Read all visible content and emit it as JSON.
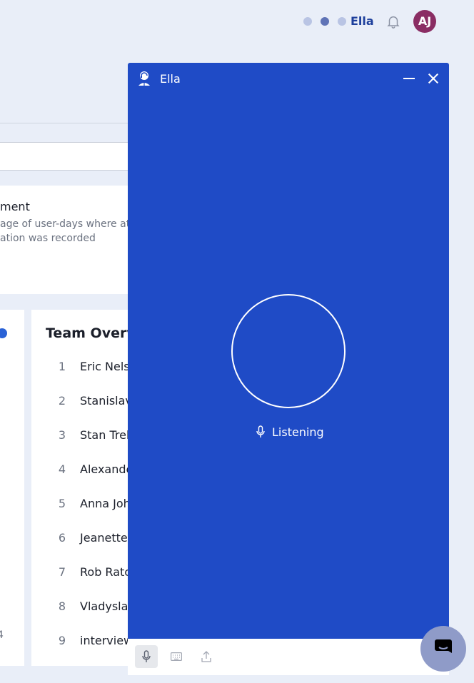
{
  "topbar": {
    "assistant_label": "Ella",
    "avatar_initials": "AJ",
    "avatar_color": "#8a2d63"
  },
  "metric_card": {
    "title": "ment",
    "desc_line1": "age of user-days where at le",
    "desc_line2": "ation was recorded"
  },
  "left_card": {
    "footer_value": "4"
  },
  "team": {
    "title": "Team Overv",
    "members": [
      {
        "rank": "1",
        "name": "Eric Nelso"
      },
      {
        "rank": "2",
        "name": "Stanislav"
      },
      {
        "rank": "3",
        "name": "Stan Treb"
      },
      {
        "rank": "4",
        "name": "Alexande"
      },
      {
        "rank": "5",
        "name": "Anna Joh"
      },
      {
        "rank": "6",
        "name": "Jeanette"
      },
      {
        "rank": "7",
        "name": "Rob Ratc"
      },
      {
        "rank": "8",
        "name": "Vladyslav"
      },
      {
        "rank": "9",
        "name": "interview"
      }
    ]
  },
  "panel": {
    "title": "Ella",
    "status": "Listening",
    "accent_color": "#1f4bc6",
    "icons": {
      "logo": "ella-logo-icon",
      "minimize": "minimize-icon",
      "close": "close-icon",
      "mic": "microphone-icon",
      "keyboard": "keyboard-icon",
      "upload": "upload-icon"
    }
  },
  "fab": {
    "icon": "chat-icon",
    "color": "#8f9bc8"
  }
}
